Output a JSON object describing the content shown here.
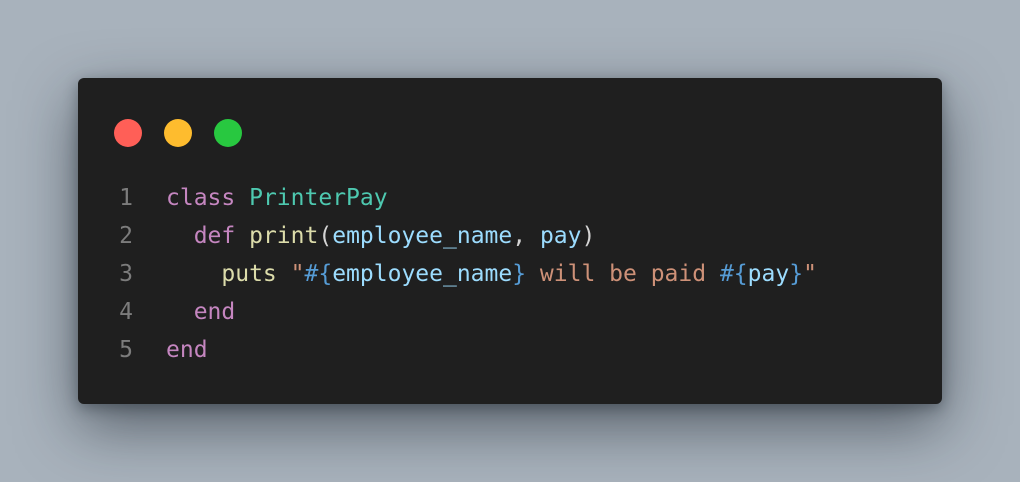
{
  "window": {
    "controls": [
      "close",
      "minimize",
      "maximize"
    ],
    "colors": {
      "close": "#ff5f57",
      "minimize": "#febc2e",
      "maximize": "#28c840",
      "background": "#1f1f1f"
    }
  },
  "code": {
    "language": "ruby",
    "lines": [
      {
        "number": "1",
        "tokens": [
          "class",
          " ",
          "PrinterPay"
        ]
      },
      {
        "number": "2",
        "tokens": [
          "  ",
          "def",
          " ",
          "print",
          "(",
          "employee_name",
          ", ",
          "pay",
          ")"
        ]
      },
      {
        "number": "3",
        "tokens": [
          "    ",
          "puts",
          " ",
          "\"",
          "#{",
          "employee_name",
          "}",
          " will be paid ",
          "#{",
          "pay",
          "}",
          "\""
        ]
      },
      {
        "number": "4",
        "tokens": [
          "  ",
          "end"
        ]
      },
      {
        "number": "5",
        "tokens": [
          "end"
        ]
      }
    ]
  }
}
